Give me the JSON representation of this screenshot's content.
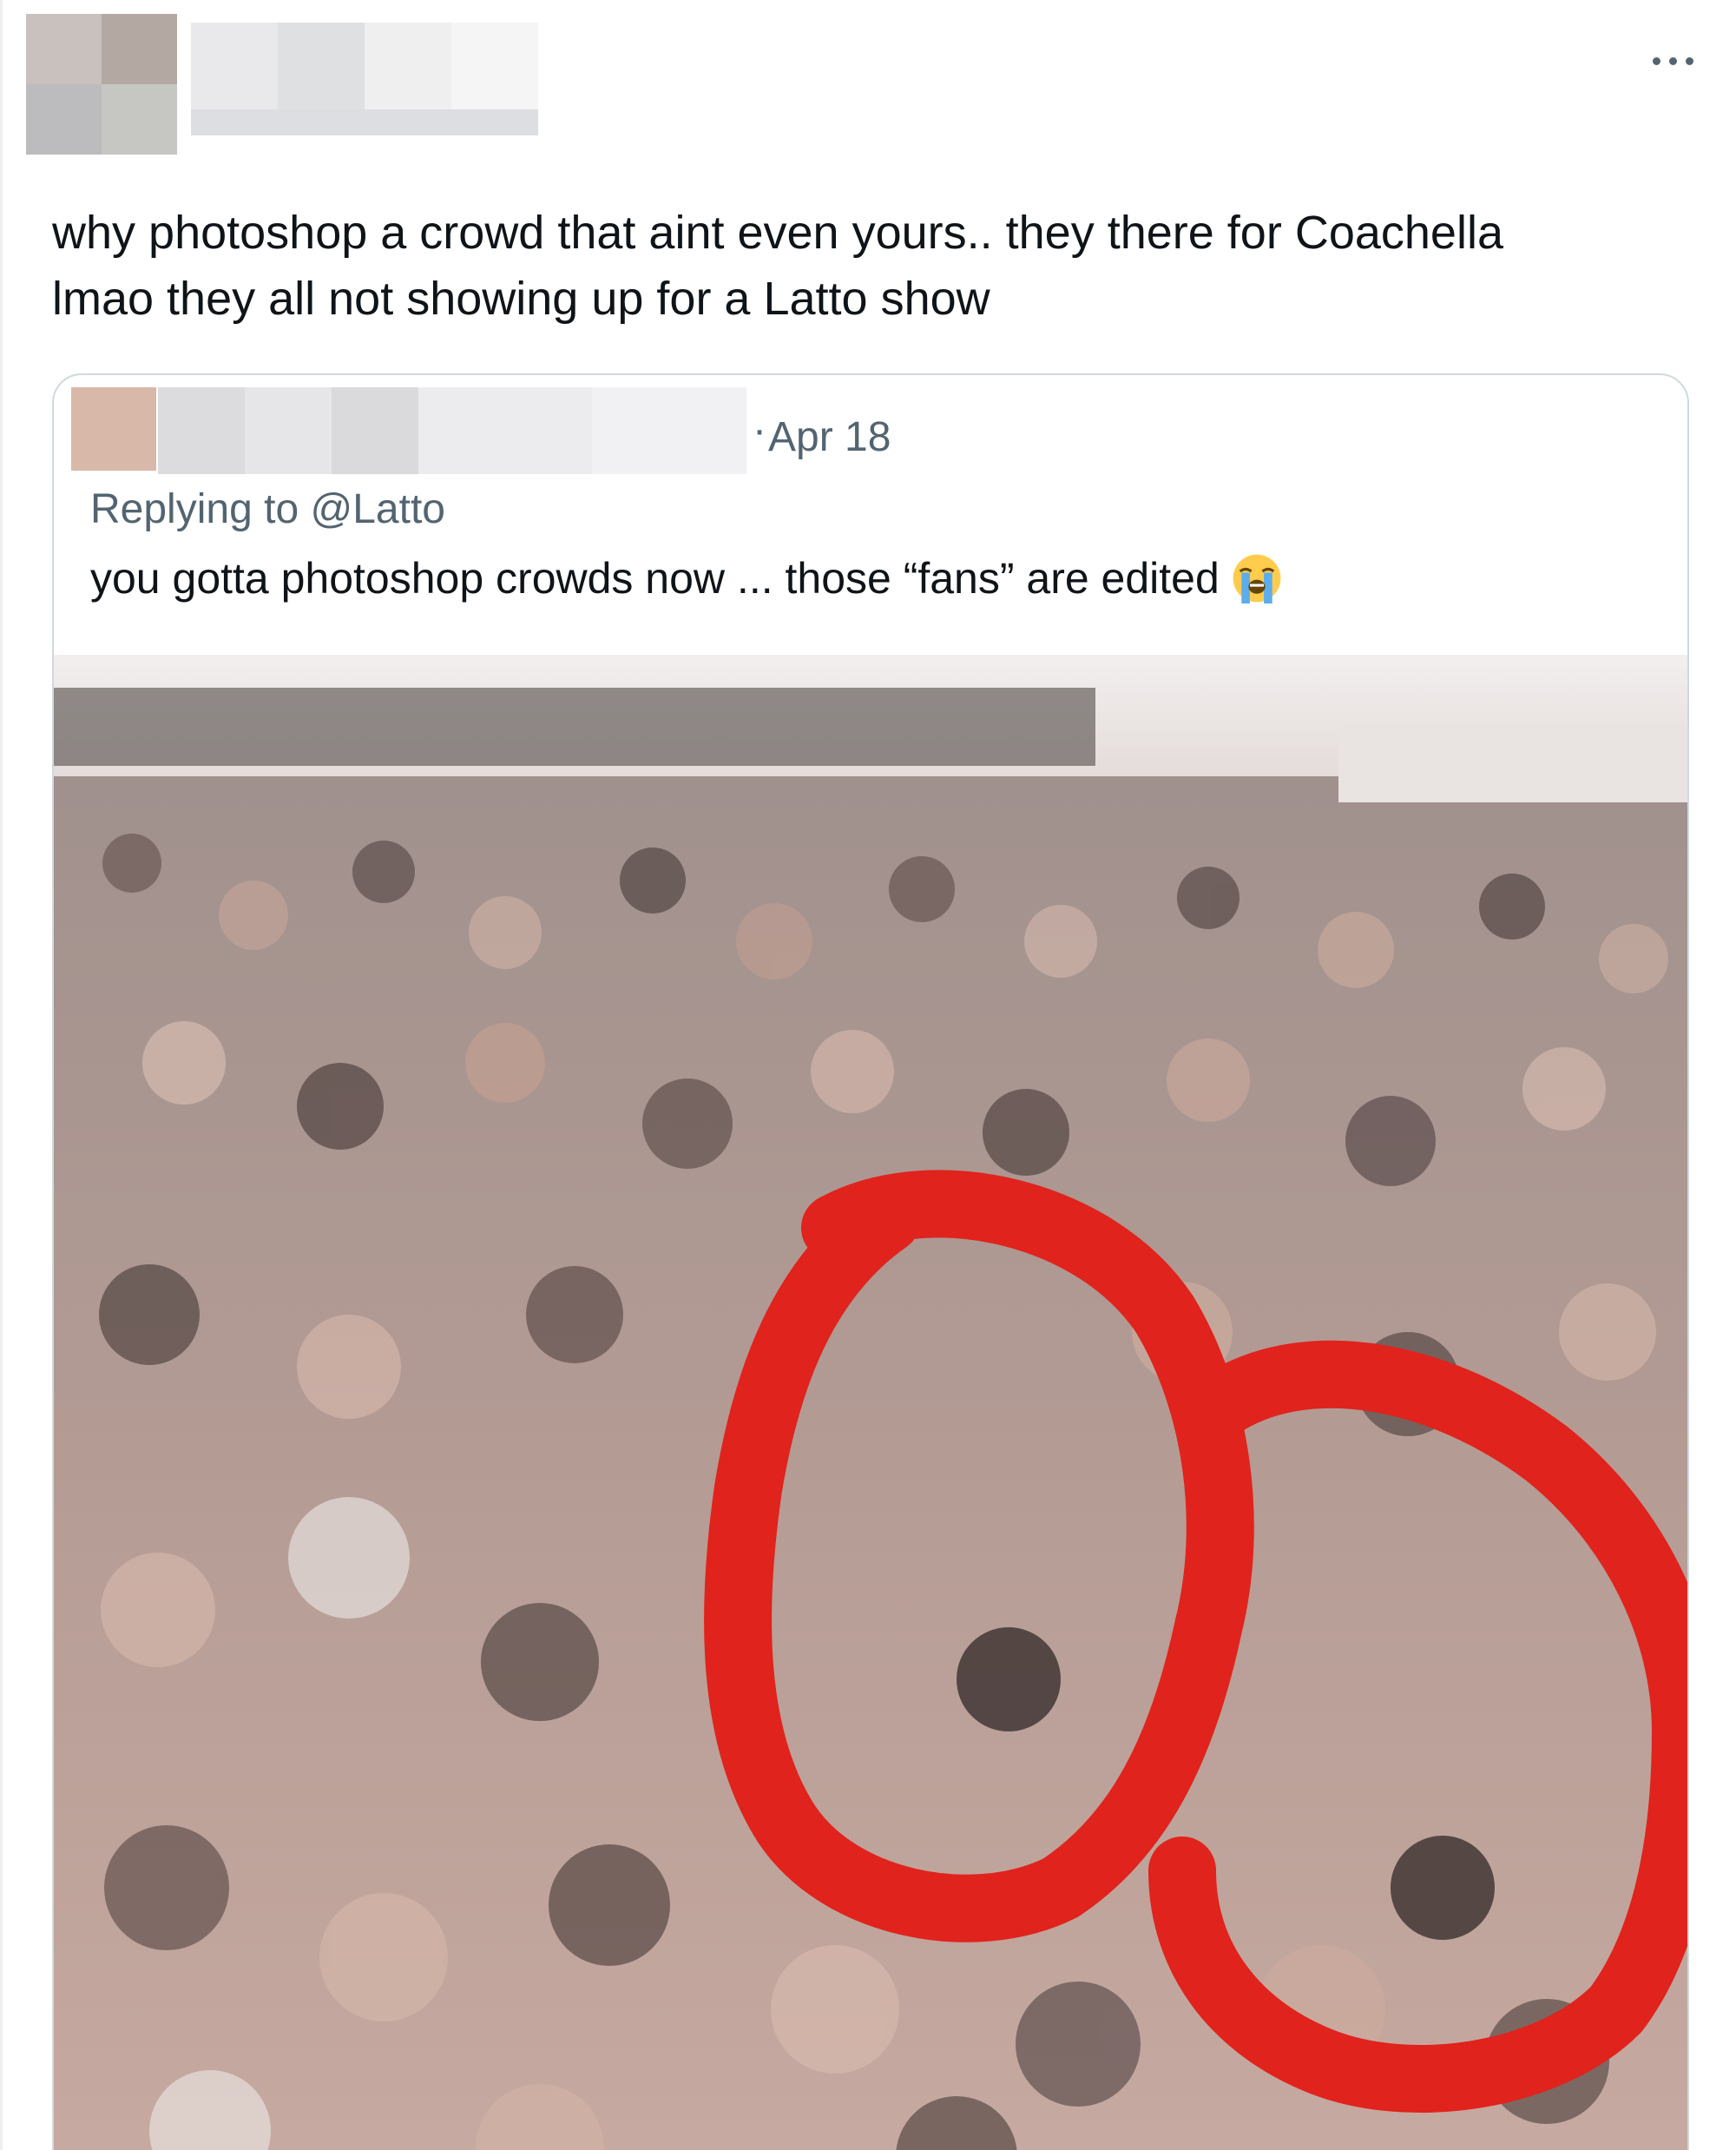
{
  "tweet": {
    "text_line1": "why photoshop a crowd that aint even yours.. they there for Coachella",
    "text_line2": "lmao they all not showing up for a Latto show",
    "more_label": "More"
  },
  "quoted_tweet": {
    "separator": "·",
    "date": "Apr 18",
    "replying_prefix": "Replying to ",
    "replying_handle": "@Latto",
    "text": "you gotta photoshop crowds now ... those “fans” are edited",
    "emoji": "loudly-crying-face-icon",
    "image_alt": "Festival crowd photo with two red circles around similar faces"
  },
  "colors": {
    "text_primary": "#0f1419",
    "text_secondary": "#536471",
    "card_border": "#cfd9de",
    "annotation_red": "#e0231c"
  }
}
